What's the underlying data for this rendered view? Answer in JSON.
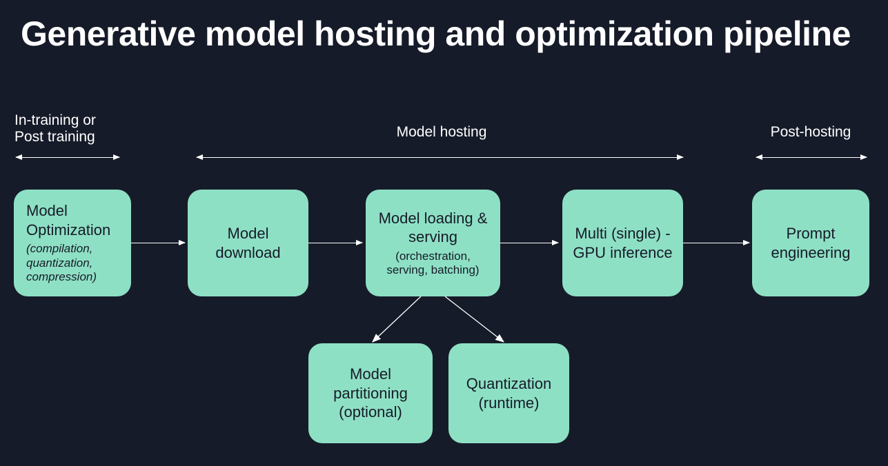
{
  "title": "Generative model hosting and optimization pipeline",
  "phases": {
    "pre": "In-training or\nPost training",
    "mid": "Model hosting",
    "post": "Post-hosting"
  },
  "boxes": {
    "optimization": {
      "title": "Model Optimization",
      "sub": "(compilation, quantization, compression)"
    },
    "download": {
      "title": "Model download"
    },
    "serving": {
      "title": "Model loading & serving",
      "sub": "(orchestration, serving, batching)"
    },
    "gpu": {
      "title": "Multi (single) - GPU inference"
    },
    "prompt": {
      "title": "Prompt engineering"
    },
    "partition": {
      "title": "Model partitioning (optional)"
    },
    "quant": {
      "title": "Quantization (runtime)"
    }
  }
}
